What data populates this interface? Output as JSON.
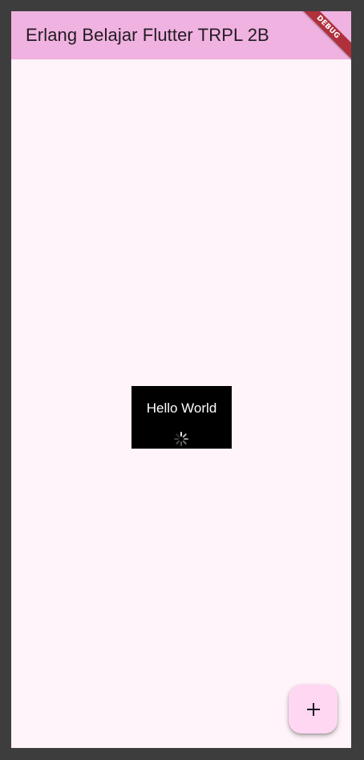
{
  "app": {
    "title": "Erlang Belajar Flutter TRPL 2B",
    "debug_banner": "DEBUG"
  },
  "content": {
    "card_text": "Hello World",
    "loading_indicator": "spinner-icon"
  },
  "fab": {
    "icon": "plus-icon"
  },
  "colors": {
    "app_bar": "#f0b2e0",
    "background": "#fff4f9",
    "card": "#000000",
    "fab": "#ffd7f2",
    "debug_banner": "#b0303c",
    "frame": "#3d3d3d"
  }
}
